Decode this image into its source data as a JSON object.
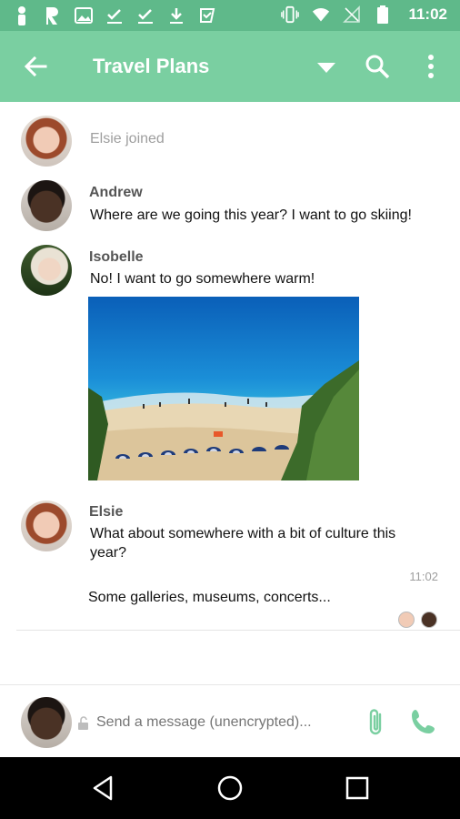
{
  "status_bar": {
    "time": "11:02"
  },
  "app_bar": {
    "title": "Travel Plans"
  },
  "timeline": {
    "system_event": "Elsie joined",
    "messages": [
      {
        "sender": "Andrew",
        "text": "Where are we going this year? I want to go skiing!"
      },
      {
        "sender": "Isobelle",
        "text": "No! I want to go somewhere warm!",
        "image": "beach-photo"
      },
      {
        "sender": "Elsie",
        "text": "What about somewhere with a bit of culture this year?",
        "time": "11:02",
        "text2": "Some galleries, museums, concerts..."
      }
    ]
  },
  "composer": {
    "placeholder": "Send a message (unencrypted)..."
  },
  "colors": {
    "status_bar": "#5fb98a",
    "app_bar": "#7acfa1",
    "accent": "#7acfa1"
  },
  "icons": [
    "back-arrow-icon",
    "dropdown-arrow-icon",
    "search-icon",
    "more-vert-icon",
    "lock-icon",
    "attach-icon",
    "call-icon",
    "nav-back-icon",
    "nav-home-icon",
    "nav-recents-icon"
  ]
}
